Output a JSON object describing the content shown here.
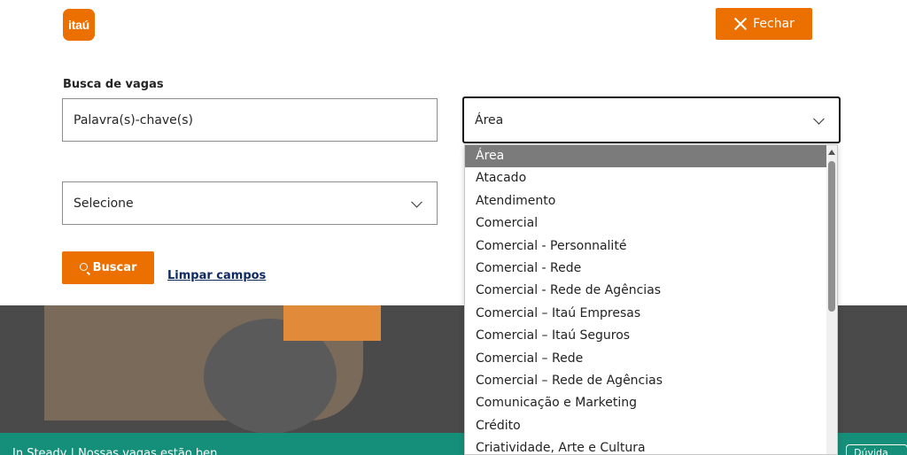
{
  "logo": {
    "text": "itaú"
  },
  "header": {
    "close_label": "Fechar"
  },
  "search": {
    "title": "Busca de vagas",
    "keyword_placeholder": "Palavra(s)-chave(s)",
    "area_value": "Área",
    "location_value": "Selecione",
    "search_label": "Buscar",
    "clear_label": "Limpar campos"
  },
  "dropdown": {
    "items": [
      "Área",
      "Atacado",
      "Atendimento",
      "Comercial",
      "Comercial - Personnalité",
      "Comercial - Rede",
      "Comercial - Rede de Agências",
      "Comercial – Itaú Empresas",
      "Comercial – Itaú Seguros",
      "Comercial – Rede",
      "Comercial – Rede de Agências",
      "Comunicação e Marketing",
      "Crédito",
      "Criatividade, Arte e Cultura"
    ]
  },
  "footer": {
    "text": "In Steady | Nossas vagas estão ben",
    "right_text": "Dúvida"
  },
  "colors": {
    "brand": "#ec7000",
    "footer": "#168f7a",
    "link": "#0f2a63"
  }
}
